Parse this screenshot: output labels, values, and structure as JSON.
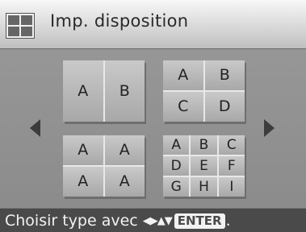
{
  "header": {
    "icon": "layout-grid-icon",
    "title": "Imp. disposition"
  },
  "layouts": {
    "two_up": [
      "A",
      "B"
    ],
    "four_up": [
      "A",
      "B",
      "C",
      "D"
    ],
    "four_same": [
      "A",
      "A",
      "A",
      "A"
    ],
    "nine_up": [
      "A",
      "B",
      "C",
      "D",
      "E",
      "F",
      "G",
      "H",
      "I"
    ]
  },
  "navigation": {
    "left": "arrow-left-icon",
    "right": "arrow-right-icon"
  },
  "footer": {
    "hint": "Choisir type avec",
    "nav_glyphs": "◀▶▲▼",
    "enter_label": "ENTER",
    "end": "."
  }
}
